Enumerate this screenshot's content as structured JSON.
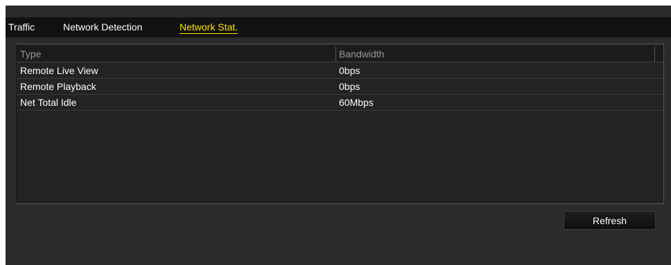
{
  "tabs": [
    {
      "label": "Traffic",
      "active": false
    },
    {
      "label": "Network Detection",
      "active": false
    },
    {
      "label": "Network Stat.",
      "active": true
    }
  ],
  "table": {
    "columns": [
      "Type",
      "Bandwidth"
    ],
    "rows": [
      {
        "type": "Remote Live View",
        "bandwidth": "0bps"
      },
      {
        "type": "Remote Playback",
        "bandwidth": "0bps"
      },
      {
        "type": "Net Total Idle",
        "bandwidth": "60Mbps"
      }
    ]
  },
  "actions": {
    "refresh_label": "Refresh"
  },
  "colors": {
    "active_tab": "#ffe600",
    "panel_bg": "#2b2b2b",
    "tabbar_bg": "#111111"
  }
}
